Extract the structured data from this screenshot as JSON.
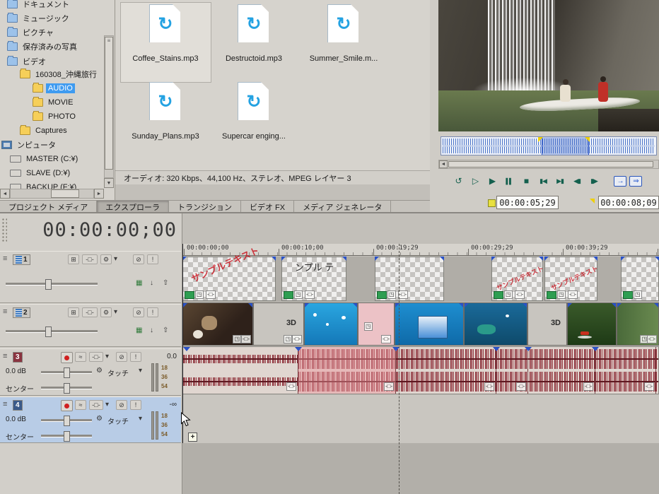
{
  "explorer": {
    "tree_items": [
      {
        "label": "ドキュメント"
      },
      {
        "label": "ミュージック"
      },
      {
        "label": "ピクチャ"
      },
      {
        "label": "保存済みの写真"
      },
      {
        "label": "ビデオ"
      },
      {
        "label": "160308_沖縄旅行"
      },
      {
        "label": "AUDIO"
      },
      {
        "label": "MOVIE"
      },
      {
        "label": "PHOTO"
      },
      {
        "label": "Captures"
      },
      {
        "label": "ンピュータ"
      },
      {
        "label": "MASTER (C:¥)"
      },
      {
        "label": "SLAVE (D:¥)"
      },
      {
        "label": "BACKUP (F:¥)"
      }
    ],
    "files": [
      {
        "name": "Coffee_Stains.mp3"
      },
      {
        "name": "Destructoid.mp3"
      },
      {
        "name": "Summer_Smile.m..."
      },
      {
        "name": "Sunday_Plans.mp3"
      },
      {
        "name": "Supercar enging..."
      }
    ],
    "status_bar": "オーディオ: 320 Kbps、44,100 Hz、ステレオ、MPEG レイヤー 3"
  },
  "dock_tabs": [
    {
      "label": "プロジェクト メディア"
    },
    {
      "label": "エクスプローラ"
    },
    {
      "label": "トランジション"
    },
    {
      "label": "ビデオ FX"
    },
    {
      "label": "メディア ジェネレータ"
    }
  ],
  "preview": {
    "selection_start": "00:00:05;29",
    "selection_end": "00:00:08;09",
    "transport": [
      {
        "name": "loop-playback",
        "glyph": "↺"
      },
      {
        "name": "play-from-start",
        "glyph": "▷"
      },
      {
        "name": "play",
        "glyph": "▶"
      },
      {
        "name": "pause",
        "glyph": "▌▌"
      },
      {
        "name": "stop",
        "glyph": "■"
      },
      {
        "name": "go-to-start",
        "glyph": "▮◀"
      },
      {
        "name": "go-to-end",
        "glyph": "▶▮"
      },
      {
        "name": "previous-frame",
        "glyph": "◀▮"
      },
      {
        "name": "next-frame",
        "glyph": "▮▶"
      },
      {
        "name": "copy-frame",
        "glyph": "→"
      },
      {
        "name": "external-monitor",
        "glyph": "⇒"
      }
    ]
  },
  "timeline": {
    "cursor_timecode": "00:00:00;00",
    "ruler_labels": [
      "00:00:00;00",
      "00:00:10;00",
      "00:00:19;29",
      "00:00:29;29",
      "00:00:39;29"
    ],
    "tracks": [
      {
        "number": "1"
      },
      {
        "number": "2"
      },
      {
        "number": "3",
        "gain": "0.0 dB",
        "pan": "センター",
        "automation": "タッチ",
        "meter_peak": "0.0",
        "meter_scale": [
          "18",
          "36",
          "54"
        ]
      },
      {
        "number": "4",
        "gain": "0.0 dB",
        "pan": "センター",
        "automation": "タッチ",
        "meter_peak": "-∞",
        "meter_scale": [
          "18",
          "36",
          "54"
        ]
      }
    ],
    "clip_text": {
      "stamp": "サンプルテキスト",
      "title_fragment": "ンプル テ",
      "stereo3d": "3D"
    }
  },
  "icons": {
    "grip": "≡",
    "gear": "⚙",
    "chevron_down": "▾",
    "mute": "⊘",
    "solo": "!",
    "envelope": "≈",
    "fx": "-□-",
    "pan_crop": "◳",
    "grid": "▦",
    "arrow_down": "↓",
    "arrow_up": "⇧",
    "track_motion": "⊞",
    "refresh": "↻",
    "scroll_left": "◄",
    "scroll_right": "►",
    "scroll_down": "▼",
    "plus": "+"
  },
  "colors": {
    "selection_blue": "#3f9bf0",
    "clip_selection_pink": "#ee969e",
    "waveform_red": "#7e2430",
    "accent_blue": "#24a2e2"
  }
}
